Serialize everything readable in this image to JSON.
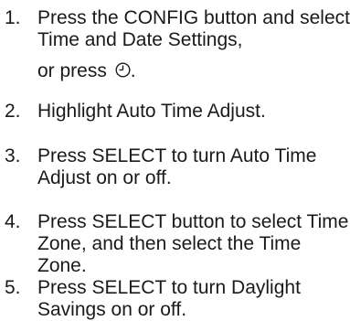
{
  "steps": [
    {
      "number": "1.",
      "text": "Press the CONFIG button and select Time and Date Settings,",
      "text_line3": "or press",
      "text_end": ".",
      "icon": "clock-icon"
    },
    {
      "number": "2.",
      "text": "Highlight Auto Time Adjust."
    },
    {
      "number": "3.",
      "text": "Press SELECT to turn Auto Time Adjust on or off."
    },
    {
      "number": "4.",
      "text": "Press SELECT button to select Time Zone, and then select the Time Zone."
    },
    {
      "number": "5.",
      "text": "Press SELECT to turn Daylight Savings on or off."
    }
  ]
}
